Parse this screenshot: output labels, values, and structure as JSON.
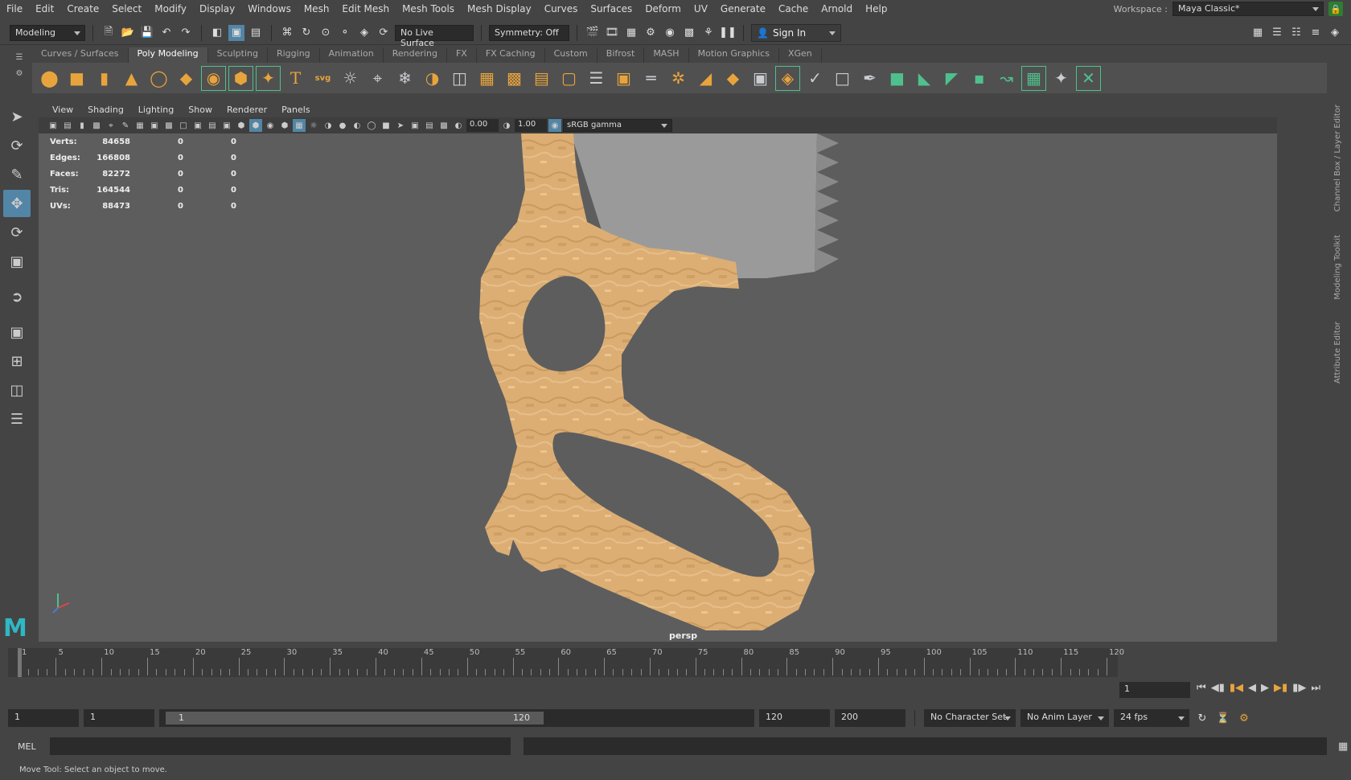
{
  "menubar": {
    "items": [
      "File",
      "Edit",
      "Create",
      "Select",
      "Modify",
      "Display",
      "Windows",
      "Mesh",
      "Edit Mesh",
      "Mesh Tools",
      "Mesh Display",
      "Curves",
      "Surfaces",
      "Deform",
      "UV",
      "Generate",
      "Cache",
      "Arnold",
      "Help"
    ],
    "workspace_label": "Workspace :",
    "workspace_value": "Maya Classic*"
  },
  "statusline": {
    "mode": "Modeling",
    "live_surface": "No Live Surface",
    "symmetry": "Symmetry: Off",
    "sign_in": "Sign In"
  },
  "shelf": {
    "tabs": [
      "Curves / Surfaces",
      "Poly Modeling",
      "Sculpting",
      "Rigging",
      "Animation",
      "Rendering",
      "FX",
      "FX Caching",
      "Custom",
      "Bifrost",
      "MASH",
      "Motion Graphics",
      "XGen"
    ],
    "active_tab": "Poly Modeling",
    "text_tool": "T",
    "svg_tool": "svg"
  },
  "viewport": {
    "menu": [
      "View",
      "Shading",
      "Lighting",
      "Show",
      "Renderer",
      "Panels"
    ],
    "exposure": "0.00",
    "gamma": "1.00",
    "color_space": "sRGB gamma",
    "camera": "persp",
    "hud": [
      {
        "label": "Verts:",
        "value": "84658",
        "sel": "0",
        "comp": "0"
      },
      {
        "label": "Edges:",
        "value": "166808",
        "sel": "0",
        "comp": "0"
      },
      {
        "label": "Faces:",
        "value": "82272",
        "sel": "0",
        "comp": "0"
      },
      {
        "label": "Tris:",
        "value": "164544",
        "sel": "0",
        "comp": "0"
      },
      {
        "label": "UVs:",
        "value": "88473",
        "sel": "0",
        "comp": "0"
      }
    ]
  },
  "right_tabs": [
    "Channel Box / Layer Editor",
    "Modeling Toolkit",
    "Attribute Editor"
  ],
  "timeline": {
    "ticks": [
      "1",
      "5",
      "10",
      "15",
      "20",
      "25",
      "30",
      "35",
      "40",
      "45",
      "50",
      "55",
      "60",
      "65",
      "70",
      "75",
      "80",
      "85",
      "90",
      "95",
      "100",
      "105",
      "110",
      "115",
      "120"
    ],
    "current_frame": "1"
  },
  "range": {
    "start_anim": "1",
    "start": "1",
    "slider_start": "1",
    "slider_end": "120",
    "end": "120",
    "end_anim": "200",
    "character_set": "No Character Set",
    "anim_layer": "No Anim Layer",
    "fps": "24 fps"
  },
  "command": {
    "language": "MEL",
    "help": "Move Tool: Select an object to move."
  },
  "colors": {
    "model": "#dcae74",
    "blade": "#9a9a9a",
    "accent_active": "#5285a6",
    "shelf_orange": "#e8a43c",
    "shelf_green": "#4fc08d"
  }
}
